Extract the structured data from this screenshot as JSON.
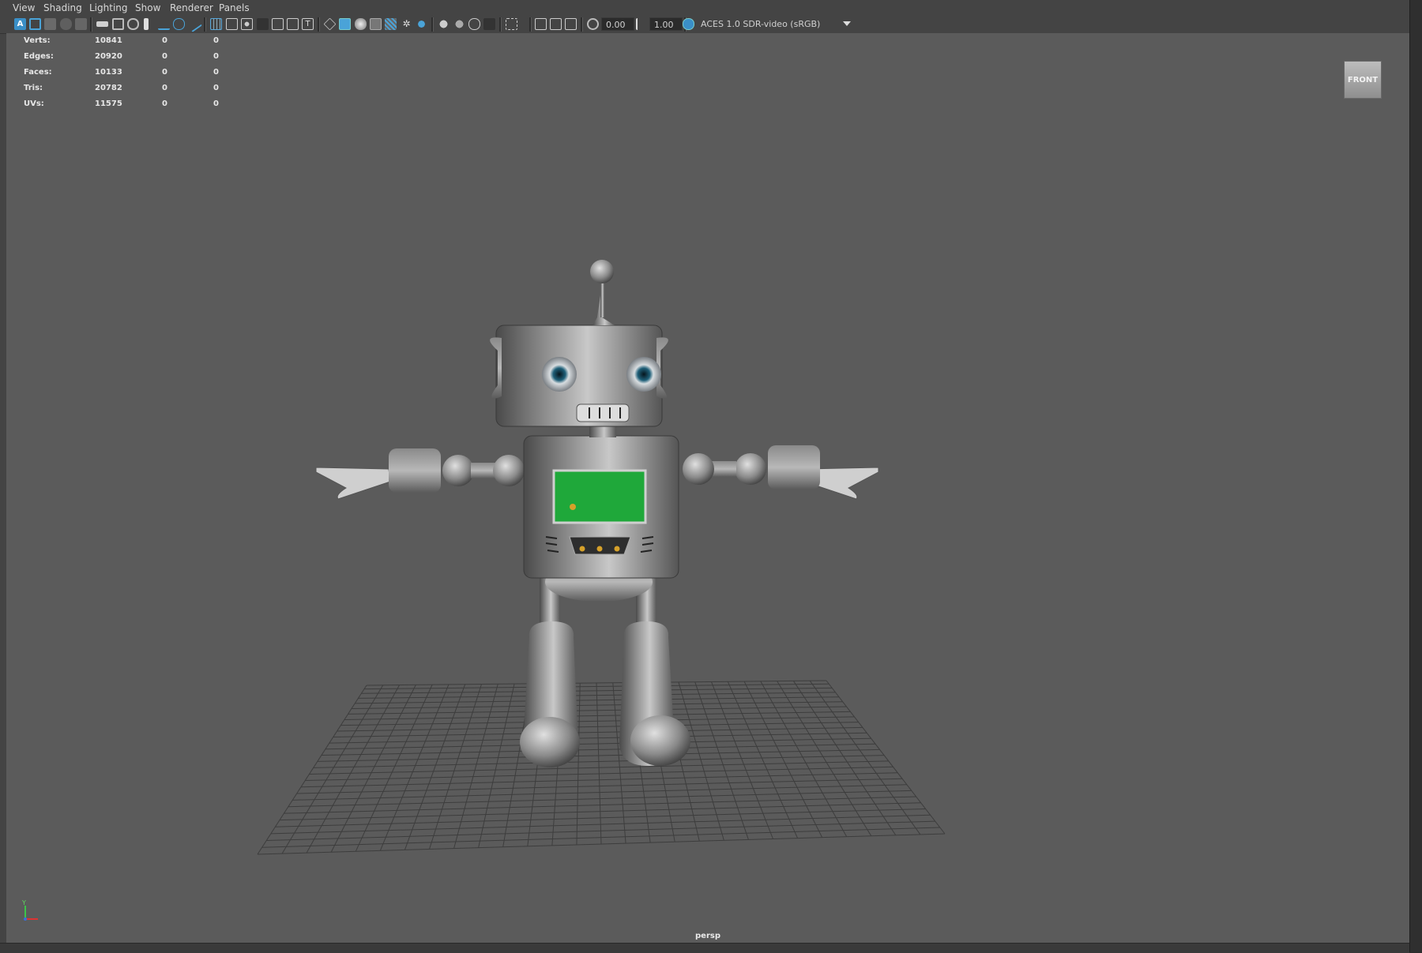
{
  "menu": {
    "items": [
      "View",
      "Shading",
      "Lighting",
      "Show",
      "Renderer",
      "Panels"
    ]
  },
  "toolbar": {
    "exposure_value": "0.00",
    "gamma_value": "1.00",
    "color_space": "ACES 1.0 SDR-video (sRGB)",
    "icons": [
      "select-camera-icon",
      "camera-attributes-icon",
      "bookmark-icon",
      "image-plane-icon",
      "2d-pan-zoom-icon",
      "grease-pencil-icon",
      "grid-icon",
      "film-gate-icon",
      "resolution-gate-icon",
      "gate-mask-icon",
      "field-chart-icon",
      "safe-action-icon",
      "safe-title-icon",
      "wireframe-icon",
      "smooth-shade-icon",
      "default-material-icon",
      "wireframe-on-shaded-icon",
      "xray-icon",
      "use-all-lights-icon",
      "shadows-icon",
      "screen-space-ao-icon",
      "motion-blur-icon",
      "multisample-aa-icon",
      "depth-of-field-icon",
      "isolate-select-icon",
      "xray-active-components-icon",
      "xray-joints-icon",
      "exposure-icon",
      "gamma-icon",
      "color-management-icon"
    ]
  },
  "hud": {
    "rows": [
      {
        "label": "Verts:",
        "total": "10841",
        "selected": "0",
        "triangles": "0"
      },
      {
        "label": "Edges:",
        "total": "20920",
        "selected": "0",
        "triangles": "0"
      },
      {
        "label": "Faces:",
        "total": "10133",
        "selected": "0",
        "triangles": "0"
      },
      {
        "label": "Tris:",
        "total": "20782",
        "selected": "0",
        "triangles": "0"
      },
      {
        "label": "UVs:",
        "total": "11575",
        "selected": "0",
        "triangles": "0"
      }
    ]
  },
  "viewcube": {
    "face": "FRONT"
  },
  "camera": {
    "name": "persp"
  },
  "axis": {
    "y_label": "Y"
  },
  "colors": {
    "viewport_bg": "#5b5b5b",
    "grid": "#3c3c3c",
    "screen_green": "#1fa83a",
    "accent_blue": "#3a8fc7"
  }
}
